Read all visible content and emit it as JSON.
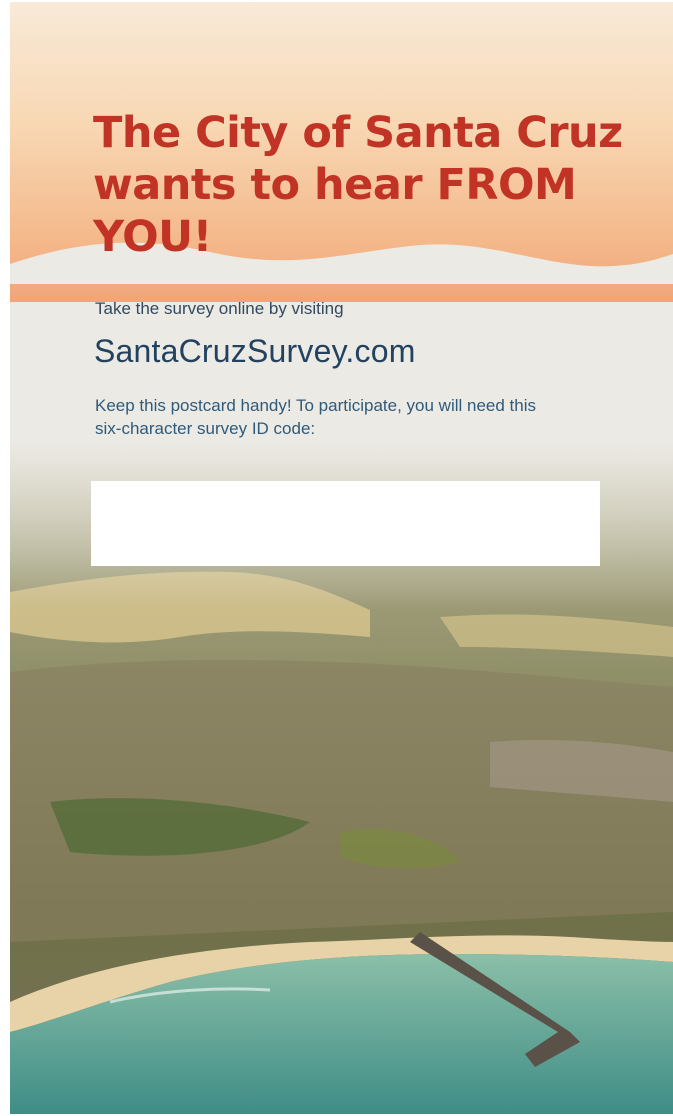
{
  "headline": {
    "line1": "The City of Santa Cruz",
    "line2": "wants to hear FROM YOU!"
  },
  "survey": {
    "intro": "Take the survey online by visiting",
    "url": "SantaCruzSurvey.com",
    "instructions": "Keep this postcard handy! To participate, you will need this six-character survey ID code:"
  },
  "code_box": {
    "value": ""
  },
  "colors": {
    "headline": "#c03325",
    "url": "#22425f",
    "body_text": "#2f5a7a",
    "card_background": "#eceae5",
    "top_gradient_light": "#f8ead8",
    "top_gradient_dark": "#f0a579"
  }
}
